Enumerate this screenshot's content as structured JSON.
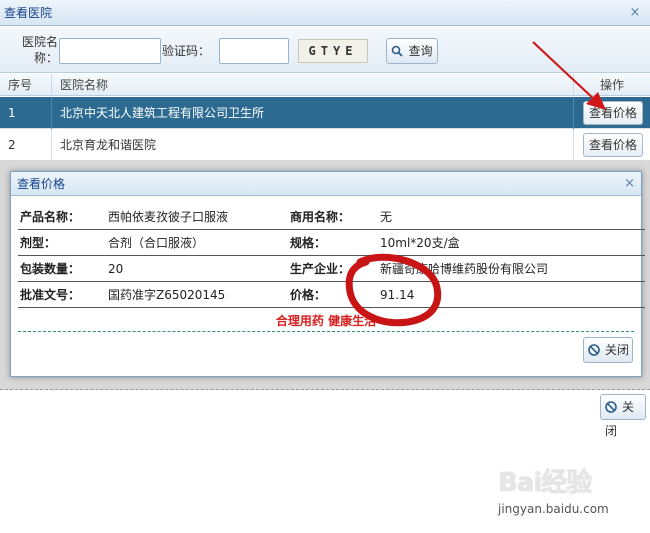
{
  "outer_window": {
    "title": "查看医院",
    "close_glyph": "×"
  },
  "search": {
    "hospital_name_label_line1": "医院名",
    "hospital_name_label_line2": "称：",
    "hospital_name_value": "",
    "captcha_label": "验证码：",
    "captcha_value": "",
    "captcha_image_text": "GTYE",
    "search_button_label": "查询"
  },
  "grid": {
    "columns": [
      "序号",
      "医院名称",
      "操作"
    ],
    "rows": [
      {
        "index": "1",
        "name": "北京中天北人建筑工程有限公司卫生所",
        "action": "查看价格",
        "selected": true
      },
      {
        "index": "2",
        "name": "北京育龙和谐医院",
        "action": "查看价格",
        "selected": false
      }
    ]
  },
  "outer_close_button_label": "关闭",
  "price_dialog": {
    "title": "查看价格",
    "close_glyph": "×",
    "fields": [
      {
        "left_label": "产品名称：",
        "left_value": "西帕依麦孜彼子口服液",
        "right_label": "商用名称：",
        "right_value": "无"
      },
      {
        "left_label": "剂型：",
        "left_value": "合剂（合口服液）",
        "right_label": "规格：",
        "right_value": "10ml*20支/盒"
      },
      {
        "left_label": "包装数量：",
        "left_value": "20",
        "right_label": "生产企业：",
        "right_value": "新疆奇康哈博维药股份有限公司"
      },
      {
        "left_label": "批准文号：",
        "left_value": "国药准字Z65020145",
        "right_label": "价格：",
        "right_value": "91.14"
      }
    ],
    "slogan": "合理用药 健康生活",
    "close_button_label": "关闭"
  },
  "watermark": {
    "logo": "Bai经验",
    "url": "jingyan.baidu.com"
  },
  "colors": {
    "selected_row": "#2d6a91",
    "annotation_red": "#d01818",
    "slogan_red": "#d82020",
    "title_text": "#15428b"
  }
}
